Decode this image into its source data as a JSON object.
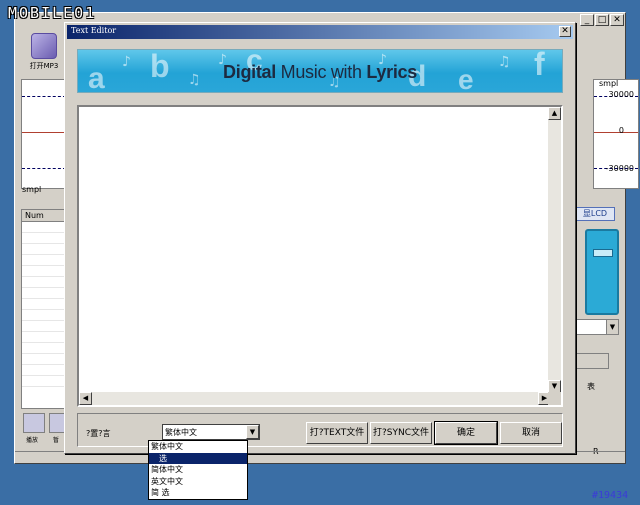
{
  "brand": {
    "logo_text": "MOBILE01"
  },
  "main_window": {
    "open_button_label": "打开MP3",
    "wave_left_label": "smpl",
    "wave_right_label": "smpl",
    "scale_top": "30000",
    "scale_mid": "0",
    "scale_bottom": "-30000",
    "list_header": "Num",
    "lcd_button": "显LCD",
    "right_label": "表",
    "right_bottom_label": "R",
    "bottom_btn_labels": [
      "播放",
      "暂"
    ]
  },
  "dialog": {
    "title": "Text Editor",
    "close_glyph": "✕",
    "banner": {
      "word1": "Digital",
      "word2": "Music with",
      "word3": "Lyrics",
      "letters": [
        "a",
        "b",
        "c",
        "d",
        "e",
        "f"
      ]
    },
    "editor": {
      "text": ""
    },
    "language_label": "?置?言",
    "language_select": {
      "value": "繁体中文",
      "options": [
        "繁体中文",
        "选",
        "简体中文",
        "英文中文",
        "简  选"
      ],
      "selected_index": 1
    },
    "buttons": {
      "open_text": "打?TEXT文件",
      "open_sync": "打?SYNC文件",
      "ok": "确定",
      "cancel": "取消"
    }
  },
  "watermark": "#19434"
}
